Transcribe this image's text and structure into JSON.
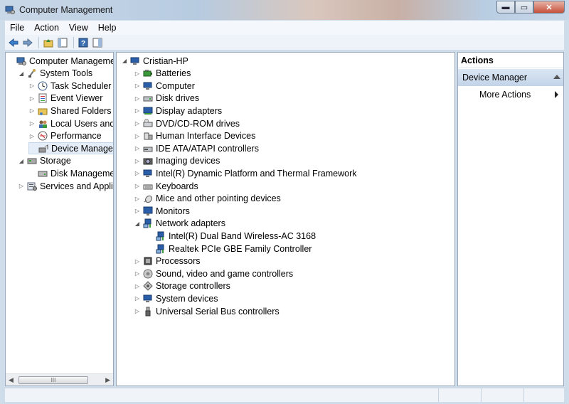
{
  "window": {
    "title": "Computer Management"
  },
  "menu": [
    "File",
    "Action",
    "View",
    "Help"
  ],
  "left_tree": [
    {
      "label": "Computer Management",
      "indent": 0,
      "twisty": "",
      "icon": "computer-management-icon",
      "selected": false
    },
    {
      "label": "System Tools",
      "indent": 1,
      "twisty": "◢",
      "icon": "tools-icon",
      "selected": false
    },
    {
      "label": "Task Scheduler",
      "indent": 2,
      "twisty": "▷",
      "icon": "clock-icon",
      "selected": false
    },
    {
      "label": "Event Viewer",
      "indent": 2,
      "twisty": "▷",
      "icon": "event-viewer-icon",
      "selected": false
    },
    {
      "label": "Shared Folders",
      "indent": 2,
      "twisty": "▷",
      "icon": "shared-folder-icon",
      "selected": false
    },
    {
      "label": "Local Users and Gro",
      "indent": 2,
      "twisty": "▷",
      "icon": "users-icon",
      "selected": false
    },
    {
      "label": "Performance",
      "indent": 2,
      "twisty": "▷",
      "icon": "performance-icon",
      "selected": false
    },
    {
      "label": "Device Manager",
      "indent": 2,
      "twisty": "",
      "icon": "device-manager-icon",
      "selected": true
    },
    {
      "label": "Storage",
      "indent": 1,
      "twisty": "◢",
      "icon": "storage-icon",
      "selected": false
    },
    {
      "label": "Disk Management",
      "indent": 2,
      "twisty": "",
      "icon": "disk-icon",
      "selected": false
    },
    {
      "label": "Services and Applicat",
      "indent": 1,
      "twisty": "▷",
      "icon": "services-icon",
      "selected": false
    }
  ],
  "device_tree": [
    {
      "label": "Cristian-HP",
      "indent": 0,
      "twisty": "◢",
      "icon": "computer-icon"
    },
    {
      "label": "Batteries",
      "indent": 1,
      "twisty": "▷",
      "icon": "battery-icon"
    },
    {
      "label": "Computer",
      "indent": 1,
      "twisty": "▷",
      "icon": "computer-icon"
    },
    {
      "label": "Disk drives",
      "indent": 1,
      "twisty": "▷",
      "icon": "disk-drive-icon"
    },
    {
      "label": "Display adapters",
      "indent": 1,
      "twisty": "▷",
      "icon": "display-adapter-icon"
    },
    {
      "label": "DVD/CD-ROM drives",
      "indent": 1,
      "twisty": "▷",
      "icon": "dvd-icon"
    },
    {
      "label": "Human Interface Devices",
      "indent": 1,
      "twisty": "▷",
      "icon": "hid-icon"
    },
    {
      "label": "IDE ATA/ATAPI controllers",
      "indent": 1,
      "twisty": "▷",
      "icon": "ide-icon"
    },
    {
      "label": "Imaging devices",
      "indent": 1,
      "twisty": "▷",
      "icon": "camera-icon"
    },
    {
      "label": "Intel(R) Dynamic Platform and Thermal Framework",
      "indent": 1,
      "twisty": "▷",
      "icon": "computer-icon"
    },
    {
      "label": "Keyboards",
      "indent": 1,
      "twisty": "▷",
      "icon": "keyboard-icon"
    },
    {
      "label": "Mice and other pointing devices",
      "indent": 1,
      "twisty": "▷",
      "icon": "mouse-icon"
    },
    {
      "label": "Monitors",
      "indent": 1,
      "twisty": "▷",
      "icon": "monitor-icon"
    },
    {
      "label": "Network adapters",
      "indent": 1,
      "twisty": "◢",
      "icon": "network-icon"
    },
    {
      "label": "Intel(R) Dual Band Wireless-AC 3168",
      "indent": 2,
      "twisty": "",
      "icon": "network-icon"
    },
    {
      "label": "Realtek PCIe GBE Family Controller",
      "indent": 2,
      "twisty": "",
      "icon": "network-icon"
    },
    {
      "label": "Processors",
      "indent": 1,
      "twisty": "▷",
      "icon": "processor-icon"
    },
    {
      "label": "Sound, video and game controllers",
      "indent": 1,
      "twisty": "▷",
      "icon": "speaker-icon"
    },
    {
      "label": "Storage controllers",
      "indent": 1,
      "twisty": "▷",
      "icon": "storage-controller-icon"
    },
    {
      "label": "System devices",
      "indent": 1,
      "twisty": "▷",
      "icon": "computer-icon"
    },
    {
      "label": "Universal Serial Bus controllers",
      "indent": 1,
      "twisty": "▷",
      "icon": "usb-icon"
    }
  ],
  "actions": {
    "header": "Actions",
    "selected": "Device Manager",
    "more": "More Actions"
  },
  "scrollbar": {
    "grip": "III"
  },
  "colors": {
    "selection": "#e5eef8",
    "actions_selected": "#c3d4e9"
  }
}
